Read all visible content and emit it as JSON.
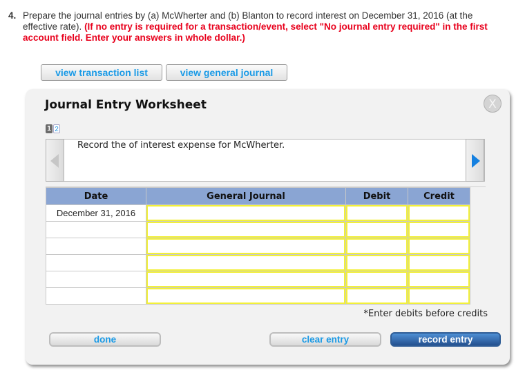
{
  "question": {
    "number": "4.",
    "text": "Prepare the journal entries by (a) McWherter and (b) Blanton to record interest on December 31, 2016 (at the effective rate).",
    "instruction": "(If no entry is required for a transaction/event, select \"No journal entry required\" in the first account field. Enter your answers in whole dollar.)"
  },
  "toolbar": {
    "view_transaction_list": "view transaction list",
    "view_general_journal": "view general journal"
  },
  "worksheet": {
    "title": "Journal Entry Worksheet",
    "close_label": "X",
    "pages": [
      "1",
      "2"
    ],
    "active_page": 1,
    "description": "Record the of interest expense for McWherter.",
    "columns": [
      "Date",
      "General Journal",
      "Debit",
      "Credit"
    ],
    "rows": [
      {
        "date": "December 31, 2016",
        "account": "",
        "debit": "",
        "credit": ""
      },
      {
        "date": "",
        "account": "",
        "debit": "",
        "credit": ""
      },
      {
        "date": "",
        "account": "",
        "debit": "",
        "credit": ""
      },
      {
        "date": "",
        "account": "",
        "debit": "",
        "credit": ""
      },
      {
        "date": "",
        "account": "",
        "debit": "",
        "credit": ""
      },
      {
        "date": "",
        "account": "",
        "debit": "",
        "credit": ""
      }
    ],
    "note": "*Enter debits before credits",
    "buttons": {
      "done": "done",
      "clear_entry": "clear entry",
      "record_entry": "record entry"
    }
  },
  "colors": {
    "instruction_red": "#e8001c",
    "link_blue": "#1a9ae6",
    "header_blue": "#8aa5d3",
    "input_border_yellow": "#f2f03a",
    "record_button_blue": "#2f5d96"
  }
}
